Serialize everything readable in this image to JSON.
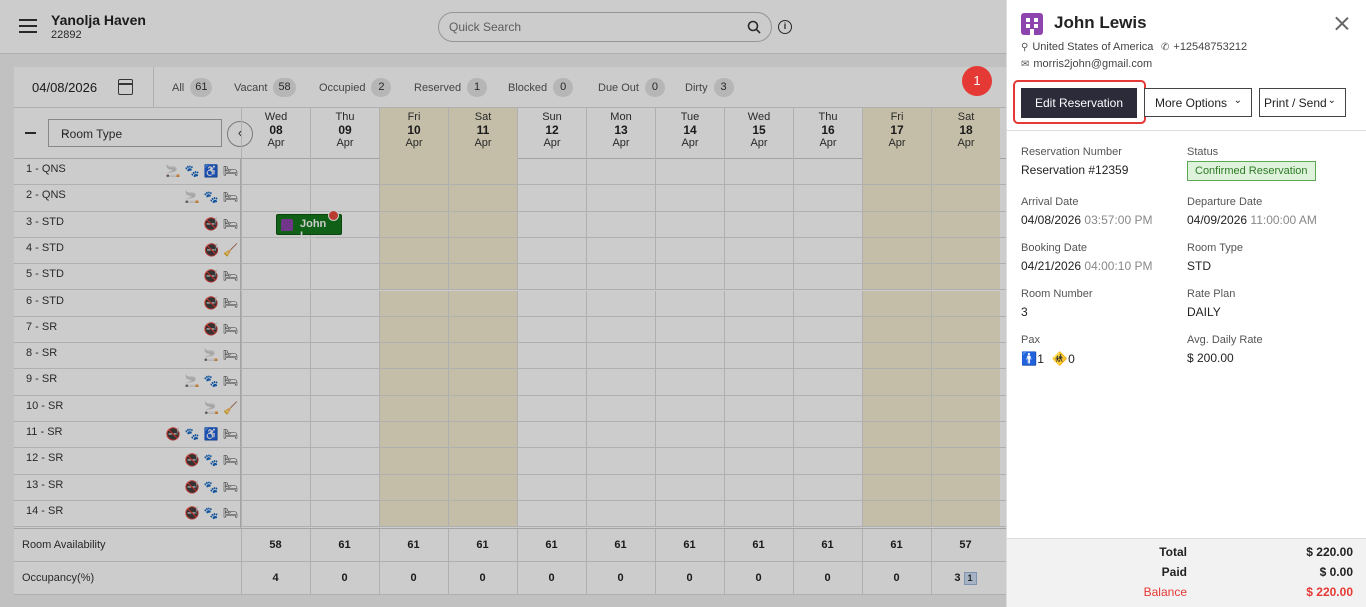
{
  "header": {
    "hotel_name": "Yanolja Haven",
    "hotel_id": "22892",
    "search_placeholder": "Quick Search"
  },
  "filterbar": {
    "date": "04/08/2026",
    "filters": [
      {
        "label": "All",
        "count": "61"
      },
      {
        "label": "Vacant",
        "count": "58"
      },
      {
        "label": "Occupied",
        "count": "2"
      },
      {
        "label": "Reserved",
        "count": "1"
      },
      {
        "label": "Blocked",
        "count": "0"
      },
      {
        "label": "Due Out",
        "count": "0"
      },
      {
        "label": "Dirty",
        "count": "3"
      }
    ]
  },
  "grid": {
    "room_type_label": "Room Type",
    "days": [
      {
        "dow": "Wed",
        "num": "08",
        "mon": "Apr",
        "weekend": false
      },
      {
        "dow": "Thu",
        "num": "09",
        "mon": "Apr",
        "weekend": false
      },
      {
        "dow": "Fri",
        "num": "10",
        "mon": "Apr",
        "weekend": true
      },
      {
        "dow": "Sat",
        "num": "11",
        "mon": "Apr",
        "weekend": true
      },
      {
        "dow": "Sun",
        "num": "12",
        "mon": "Apr",
        "weekend": false
      },
      {
        "dow": "Mon",
        "num": "13",
        "mon": "Apr",
        "weekend": false
      },
      {
        "dow": "Tue",
        "num": "14",
        "mon": "Apr",
        "weekend": false
      },
      {
        "dow": "Wed",
        "num": "15",
        "mon": "Apr",
        "weekend": false
      },
      {
        "dow": "Thu",
        "num": "16",
        "mon": "Apr",
        "weekend": false
      },
      {
        "dow": "Fri",
        "num": "17",
        "mon": "Apr",
        "weekend": true
      },
      {
        "dow": "Sat",
        "num": "18",
        "mon": "Apr",
        "weekend": true
      }
    ],
    "rooms": [
      {
        "name": "1 - QNS",
        "icons": [
          "smoking",
          "pet",
          "wheelchair",
          "bed"
        ]
      },
      {
        "name": "2 - QNS",
        "icons": [
          "smoking",
          "pet",
          "bed"
        ]
      },
      {
        "name": "3 - STD",
        "icons": [
          "no-smoking",
          "bed"
        ]
      },
      {
        "name": "4 - STD",
        "icons": [
          "no-smoking",
          "dirty"
        ]
      },
      {
        "name": "5 - STD",
        "icons": [
          "no-smoking",
          "bed"
        ]
      },
      {
        "name": "6 - STD",
        "icons": [
          "no-smoking",
          "bed"
        ]
      },
      {
        "name": "7 - SR",
        "icons": [
          "no-smoking",
          "bed"
        ]
      },
      {
        "name": "8 - SR",
        "icons": [
          "smoking",
          "bed"
        ]
      },
      {
        "name": "9 - SR",
        "icons": [
          "smoking",
          "pet",
          "bed"
        ]
      },
      {
        "name": "10 - SR",
        "icons": [
          "smoking",
          "dirty"
        ]
      },
      {
        "name": "11 - SR",
        "icons": [
          "no-smoking",
          "pet",
          "wheelchair",
          "bed"
        ]
      },
      {
        "name": "12 - SR",
        "icons": [
          "no-smoking",
          "pet",
          "bed"
        ]
      },
      {
        "name": "13 - SR",
        "icons": [
          "no-smoking",
          "pet",
          "bed"
        ]
      },
      {
        "name": "14 - SR",
        "icons": [
          "no-smoking",
          "pet",
          "bed"
        ]
      }
    ],
    "booking_label": "John L...",
    "availability_label": "Room Availability",
    "availability": [
      "58",
      "61",
      "61",
      "61",
      "61",
      "61",
      "61",
      "61",
      "61",
      "61",
      "57"
    ],
    "occupancy_label": "Occupancy(%)",
    "occupancy": [
      "4",
      "0",
      "0",
      "0",
      "0",
      "0",
      "0",
      "0",
      "0",
      "0",
      "3"
    ],
    "occupancy_badge": "1"
  },
  "step_badge": "1",
  "panel": {
    "guest_name": "John Lewis",
    "country": "United States of America",
    "phone": "+12548753212",
    "email": "morris2john@gmail.com",
    "edit_label": "Edit Reservation",
    "more_label": "More Options",
    "print_label": "Print / Send",
    "reservation_number_label": "Reservation Number",
    "reservation_number": "Reservation #12359",
    "status_label": "Status",
    "status": "Confirmed Reservation",
    "arrival_label": "Arrival Date",
    "arrival_date": "04/08/2026",
    "arrival_time": "03:57:00 PM",
    "departure_label": "Departure Date",
    "departure_date": "04/09/2026",
    "departure_time": "11:00:00 AM",
    "booking_label": "Booking Date",
    "booking_date": "04/21/2026",
    "booking_time": "04:00:10 PM",
    "room_type_label": "Room Type",
    "room_type": "STD",
    "room_number_label": "Room Number",
    "room_number": "3",
    "rate_plan_label": "Rate Plan",
    "rate_plan": "DAILY",
    "pax_label": "Pax",
    "pax_adults": "1",
    "pax_children": "0",
    "adr_label": "Avg. Daily Rate",
    "adr": "$ 200.00",
    "total_label": "Total",
    "total": "$ 220.00",
    "paid_label": "Paid",
    "paid": "$ 0.00",
    "balance_label": "Balance",
    "balance": "$ 220.00"
  },
  "colors": {
    "booking_green": "#147a1d",
    "weekend": "#f6eed2",
    "accent_red": "#e53935",
    "primary_button": "#2b2b3a"
  }
}
